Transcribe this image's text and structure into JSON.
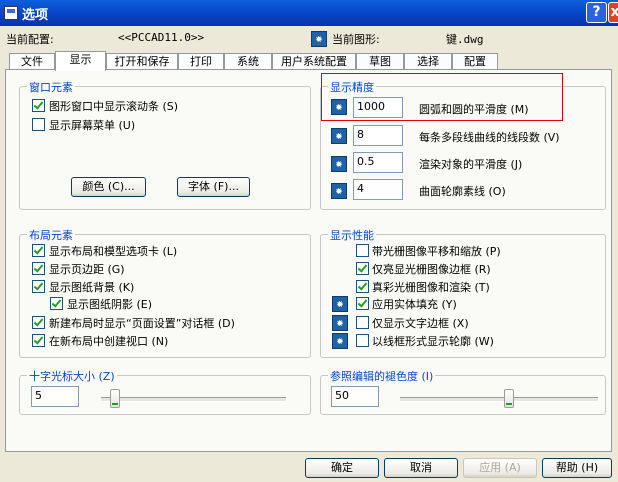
{
  "window": {
    "title": "选项",
    "help_glyph": "?",
    "close_glyph": "x"
  },
  "header": {
    "config_label": "当前配置:",
    "config_value": "<<PCCAD11.0>>",
    "drawing_label": "当前图形:",
    "drawing_value": "键.dwg"
  },
  "tabs": [
    "文件",
    "显示",
    "打开和保存",
    "打印",
    "系统",
    "用户系统配置",
    "草图",
    "选择",
    "配置"
  ],
  "active_tab": "显示",
  "window_elements": {
    "title": "窗口元素",
    "scrollbars": {
      "label": "图形窗口中显示滚动条 (S)",
      "checked": true
    },
    "screen_menu": {
      "label": "显示屏幕菜单 (U)",
      "checked": false
    },
    "colors_button": "颜色 (C)...",
    "fonts_button": "字体 (F)..."
  },
  "display_resolution": {
    "title": "显示精度",
    "items": [
      {
        "value": "1000",
        "label": "圆弧和圆的平滑度 (M)"
      },
      {
        "value": "8",
        "label": "每条多段线曲线的线段数 (V)"
      },
      {
        "value": "0.5",
        "label": "渲染对象的平滑度 (J)"
      },
      {
        "value": "4",
        "label": "曲面轮廓素线 (O)"
      }
    ]
  },
  "layout_elements": {
    "title": "布局元素",
    "items": [
      {
        "label": "显示布局和模型选项卡 (L)",
        "checked": true
      },
      {
        "label": "显示页边距 (G)",
        "checked": true
      },
      {
        "label": "显示图纸背景 (K)",
        "checked": true
      },
      {
        "label": "显示图纸阴影 (E)",
        "checked": true
      },
      {
        "label": "新建布局时显示“页面设置”对话框 (D)",
        "checked": true
      },
      {
        "label": "在新布局中创建视口 (N)",
        "checked": true
      }
    ]
  },
  "display_performance": {
    "title": "显示性能",
    "items": [
      {
        "label": "带光栅图像平移和缩放 (P)",
        "checked": false
      },
      {
        "label": "仅亮显光栅图像边框 (R)",
        "checked": true
      },
      {
        "label": "真彩光栅图像和渲染 (T)",
        "checked": true
      },
      {
        "label": "应用实体填充 (Y)",
        "checked": true
      },
      {
        "label": "仅显示文字边框 (X)",
        "checked": false
      },
      {
        "label": "以线框形式显示轮廓 (W)",
        "checked": false
      }
    ]
  },
  "crosshair": {
    "title": "十字光标大小 (Z)",
    "value": "5",
    "level": 5
  },
  "xref_fade": {
    "title": "参照编辑的褪色度 (I)",
    "value": "50",
    "level": 50
  },
  "buttons": {
    "ok": "确定",
    "cancel": "取消",
    "apply": "应用 (A)",
    "help": "帮助 (H)"
  },
  "colors": {
    "title_bar": "#0842c4",
    "group_title": "#0046d5",
    "highlight_box": "#e00000"
  }
}
